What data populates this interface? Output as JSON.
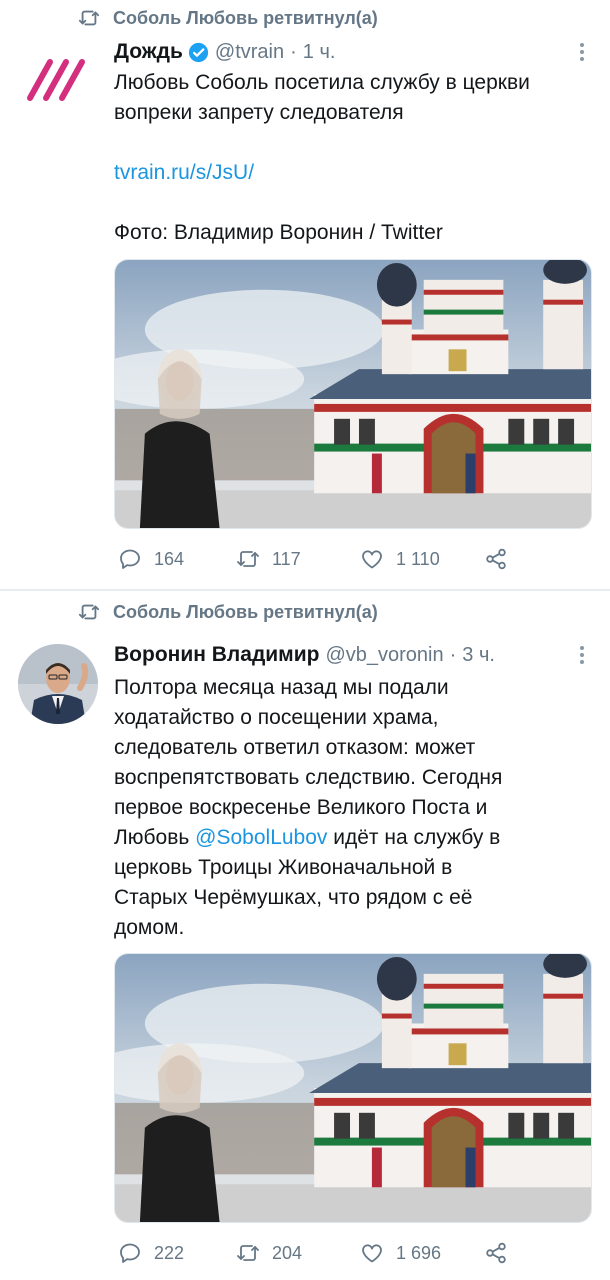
{
  "tweets": [
    {
      "retweeted_by": "Соболь Любовь ретвитнул(а)",
      "author_name": "Дождь",
      "verified": true,
      "handle": "@tvrain",
      "separator": "·",
      "time": "1 ч.",
      "text_line1": "Любовь Соболь посетила службу в церкви",
      "text_line2": "вопреки запрету следователя",
      "link": "tvrain.ru/s/JsU/",
      "photo_credit": "Фото: Владимир Воронин / Twitter",
      "replies": "164",
      "retweets": "117",
      "likes": "1 110"
    },
    {
      "retweeted_by": "Соболь Любовь ретвитнул(а)",
      "author_name": "Воронин Владимир",
      "verified": false,
      "handle": "@vb_voronin",
      "separator": "·",
      "time": "3 ч.",
      "text_part1": "Полтора месяца назад мы подали\nходатайство о посещении храма,\nследователь ответил отказом: может\nвоспрепятствовать следствию. Сегодня\nпервое воскресенье Великого Поста и\nЛюбовь ",
      "mention": "@SobolLubov",
      "text_part2": " идёт на службу в\nцерковь Троицы Живоначальной в\nСтарых Черёмушках, что рядом с её\nдомом.",
      "replies": "222",
      "retweets": "204",
      "likes": "1 696"
    }
  ],
  "icons": {
    "retweeted": "retweet-icon",
    "reply": "reply-icon",
    "retweet": "retweet-icon",
    "like": "heart-icon",
    "share": "share-icon",
    "more": "more-vertical-icon",
    "verified": "verified-badge-icon"
  },
  "colors": {
    "link": "#1b95e0",
    "secondary_text": "#657786",
    "verified": "#1da1f2",
    "dozhd_logo": "#d32f7e"
  }
}
